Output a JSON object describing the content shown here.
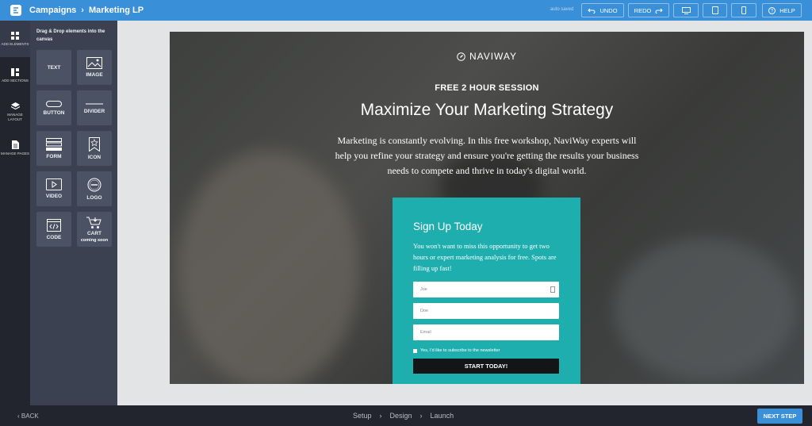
{
  "header": {
    "breadcrumbs": [
      "Campaigns",
      "Marketing LP"
    ],
    "save_status": "auto saved",
    "undo_label": "UNDO",
    "redo_label": "REDO",
    "help_label": "HELP",
    "device_icons": [
      "desktop-icon",
      "tablet-icon",
      "mobile-icon"
    ]
  },
  "rail": {
    "items": [
      {
        "label": "ADD ELEMENTS",
        "icon": "grid-icon"
      },
      {
        "label": "ADD SECTIONS",
        "icon": "sections-icon"
      },
      {
        "label": "MANAGE LAYOUT",
        "icon": "layers-icon"
      },
      {
        "label": "MANAGE PAGES",
        "icon": "page-icon"
      }
    ]
  },
  "panel": {
    "title": "Drag & Drop elements into the canvas",
    "elements": [
      {
        "label": "TEXT",
        "icon": "text-icon"
      },
      {
        "label": "IMAGE",
        "icon": "image-icon"
      },
      {
        "label": "BUTTON",
        "icon": "button-icon"
      },
      {
        "label": "DIVIDER",
        "icon": "divider-icon"
      },
      {
        "label": "FORM",
        "icon": "form-icon"
      },
      {
        "label": "ICON",
        "icon": "star-bookmark-icon"
      },
      {
        "label": "VIDEO",
        "icon": "video-icon"
      },
      {
        "label": "LOGO",
        "icon": "logo-icon"
      },
      {
        "label": "CODE",
        "icon": "code-icon"
      },
      {
        "label": "CART",
        "icon": "cart-icon",
        "badge": "coming soon"
      }
    ]
  },
  "canvas": {
    "brand": "NAVIWAY",
    "eyebrow": "FREE 2 HOUR SESSION",
    "headline": "Maximize Your Marketing Strategy",
    "lead": "Marketing is constantly evolving. In this free workshop, NaviWay experts will help you refine your strategy and ensure you're getting the results your business needs to compete and thrive in today's digital world.",
    "form": {
      "title": "Sign Up Today",
      "description": "You won't want to miss this opportunity to get two hours or expert marketing analysis for free. Spots are filling up fast!",
      "fields": [
        "Joe",
        "Doe",
        "Email"
      ],
      "checkbox_label": "Yes, I'd like to subscribe to the newsletter",
      "cta": "START TODAY!"
    },
    "colors": {
      "form_bg": "#1faeae",
      "cta_bg": "#141517"
    }
  },
  "footer": {
    "back_label": "BACK",
    "steps": [
      "Setup",
      "Design",
      "Launch"
    ],
    "next_label": "NEXT STEP"
  },
  "colors": {
    "accent": "#3a8fd9",
    "rail_bg": "#22252d",
    "panel_bg": "#3b4150"
  }
}
